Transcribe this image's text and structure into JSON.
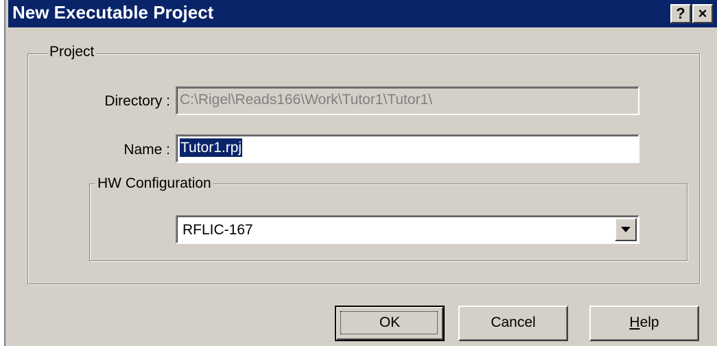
{
  "dialog": {
    "title": "New Executable Project",
    "help_icon_glyph": "?",
    "close_icon_glyph": "×"
  },
  "project_group": {
    "legend": "Project",
    "directory_label": "Directory :",
    "directory_value": "C:\\Rigel\\Reads166\\Work\\Tutor1\\Tutor1\\",
    "name_label": "Name :",
    "name_value": "Tutor1.rpj"
  },
  "hw_group": {
    "legend": "HW Configuration",
    "selected_value": "RFLIC-167"
  },
  "buttons": {
    "ok_label": "OK",
    "cancel_label": "Cancel",
    "help_label_underlined": "H",
    "help_label_rest": "elp"
  },
  "colors": {
    "titlebar": "#0a246a",
    "face": "#d4d0c8",
    "selection": "#0a246a"
  }
}
